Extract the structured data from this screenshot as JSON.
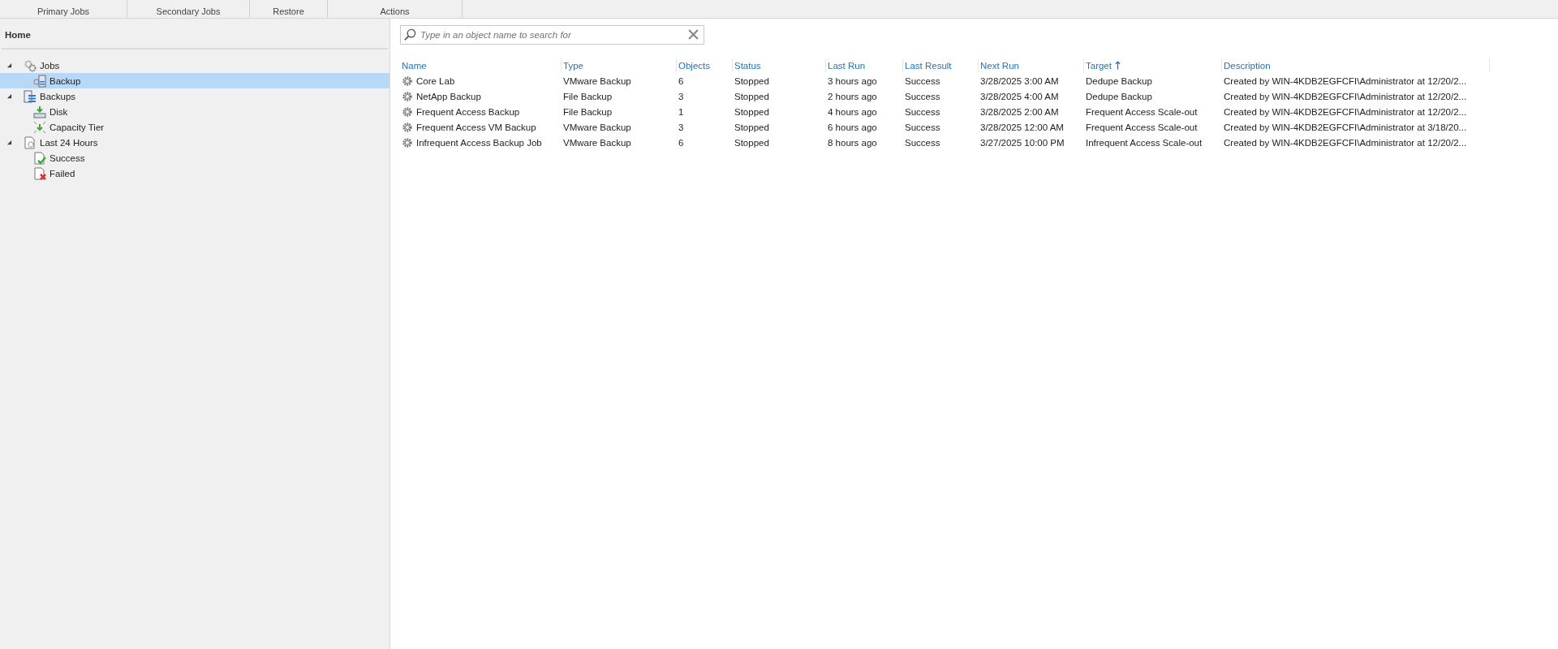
{
  "ribbon": {
    "groups": [
      "Primary Jobs",
      "Secondary Jobs",
      "Restore",
      "Actions"
    ]
  },
  "sidebar": {
    "title": "Home",
    "tree": [
      {
        "label": "Jobs",
        "kind": "gears",
        "expanded": true,
        "selected": false,
        "children": [
          {
            "label": "Backup",
            "kind": "job",
            "selected": true
          }
        ]
      },
      {
        "label": "Backups",
        "kind": "backups",
        "expanded": true,
        "selected": false,
        "children": [
          {
            "label": "Disk",
            "kind": "disk",
            "selected": false
          },
          {
            "label": "Capacity Tier",
            "kind": "capacity",
            "selected": false
          }
        ]
      },
      {
        "label": "Last 24 Hours",
        "kind": "recent",
        "expanded": true,
        "selected": false,
        "children": [
          {
            "label": "Success",
            "kind": "success",
            "selected": false
          },
          {
            "label": "Failed",
            "kind": "failed",
            "selected": false
          }
        ]
      }
    ]
  },
  "search": {
    "placeholder": "Type in an object name to search for"
  },
  "table": {
    "columns": [
      {
        "label": "Name",
        "sorted": false
      },
      {
        "label": "Type",
        "sorted": false
      },
      {
        "label": "Objects",
        "sorted": false
      },
      {
        "label": "Status",
        "sorted": false
      },
      {
        "label": "Last Run",
        "sorted": false
      },
      {
        "label": "Last Result",
        "sorted": false
      },
      {
        "label": "Next Run",
        "sorted": false
      },
      {
        "label": "Target",
        "sorted": true
      },
      {
        "label": "Description",
        "sorted": false
      }
    ],
    "rows": [
      [
        "Core Lab",
        "VMware Backup",
        "6",
        "Stopped",
        "3 hours ago",
        "Success",
        "3/28/2025 3:00 AM",
        "Dedupe Backup",
        "Created by WIN-4KDB2EGFCFI\\Administrator at 12/20/2..."
      ],
      [
        "NetApp Backup",
        "File Backup",
        "3",
        "Stopped",
        "2 hours ago",
        "Success",
        "3/28/2025 4:00 AM",
        "Dedupe Backup",
        "Created by WIN-4KDB2EGFCFI\\Administrator at 12/20/2..."
      ],
      [
        "Frequent Access Backup",
        "File Backup",
        "1",
        "Stopped",
        "4 hours ago",
        "Success",
        "3/28/2025 2:00 AM",
        "Frequent Access Scale-out",
        "Created by WIN-4KDB2EGFCFI\\Administrator at 12/20/2..."
      ],
      [
        "Frequent Access VM Backup",
        "VMware Backup",
        "3",
        "Stopped",
        "6 hours ago",
        "Success",
        "3/28/2025 12:00 AM",
        "Frequent Access Scale-out",
        "Created by WIN-4KDB2EGFCFI\\Administrator at 3/18/20..."
      ],
      [
        "Infrequent Access Backup Job",
        "VMware Backup",
        "6",
        "Stopped",
        "8 hours ago",
        "Success",
        "3/27/2025 10:00 PM",
        "Infrequent Access Scale-out",
        "Created by WIN-4KDB2EGFCFI\\Administrator at 12/20/2..."
      ]
    ]
  }
}
